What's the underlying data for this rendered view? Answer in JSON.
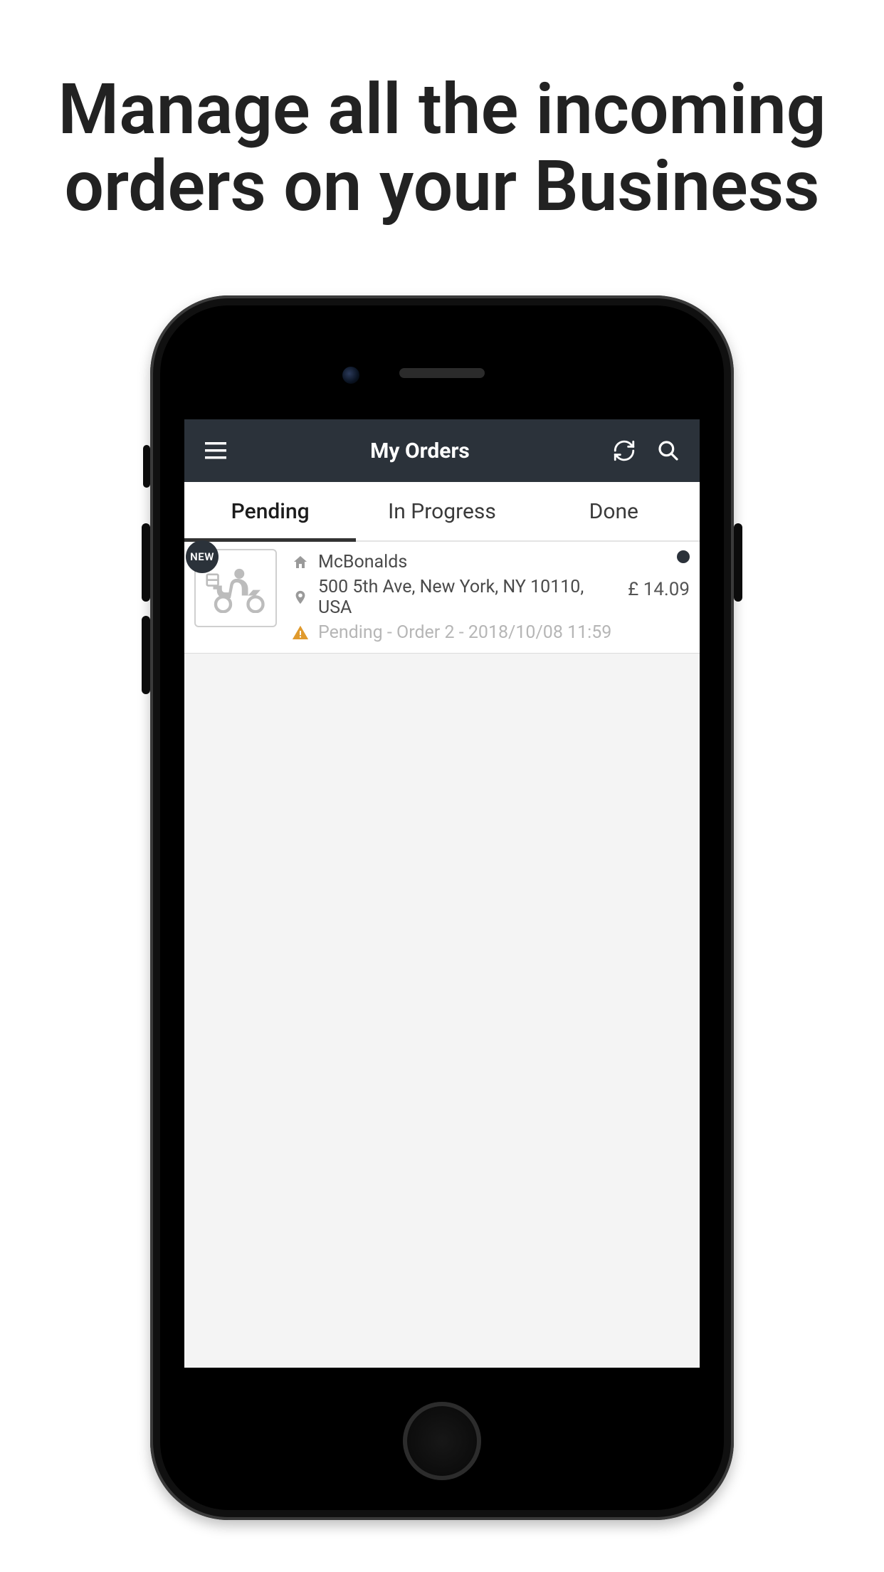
{
  "headline": "Manage all the incoming orders on your Business",
  "appbar": {
    "title": "My Orders"
  },
  "tabs": [
    {
      "label": "Pending",
      "active": true
    },
    {
      "label": "In Progress",
      "active": false
    },
    {
      "label": "Done",
      "active": false
    }
  ],
  "orders": [
    {
      "badge": "NEW",
      "merchant": "McBonalds",
      "address": "500 5th Ave, New York, NY 10110, USA",
      "status": "Pending - Order 2 - 2018/10/08 11:59",
      "price": "£ 14.09"
    }
  ]
}
